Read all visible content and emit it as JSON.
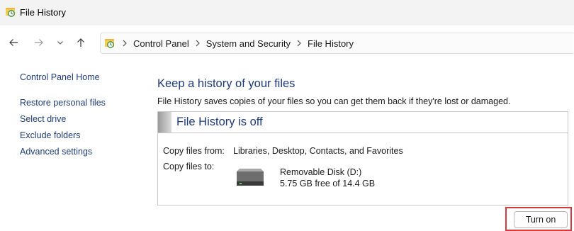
{
  "window": {
    "title": "File History",
    "icon": "file-history-icon"
  },
  "toolbar": {
    "back_icon": "arrow-left-icon",
    "forward_icon": "arrow-right-icon",
    "recent_icon": "chevron-down-icon",
    "up_icon": "arrow-up-icon",
    "breadcrumb": [
      "Control Panel",
      "System and Security",
      "File History"
    ]
  },
  "sidebar": {
    "items": [
      {
        "label": "Control Panel Home"
      },
      {
        "label": "Restore personal files"
      },
      {
        "label": "Select drive"
      },
      {
        "label": "Exclude folders"
      },
      {
        "label": "Advanced settings"
      }
    ]
  },
  "main": {
    "heading": "Keep a history of your files",
    "description": "File History saves copies of your files so you can get them back if they're lost or damaged.",
    "status_title": "File History is off",
    "copy_from_label": "Copy files from:",
    "copy_from_value": "Libraries, Desktop, Contacts, and Favorites",
    "copy_to_label": "Copy files to:",
    "drive_name": "Removable Disk (D:)",
    "drive_free": "5.75 GB free of 14.4 GB",
    "drive_icon": "drive-icon",
    "turn_on_label": "Turn on"
  },
  "colors": {
    "link": "#1f3d7a",
    "heading": "#1e3a78",
    "highlight": "#d63a3a"
  }
}
